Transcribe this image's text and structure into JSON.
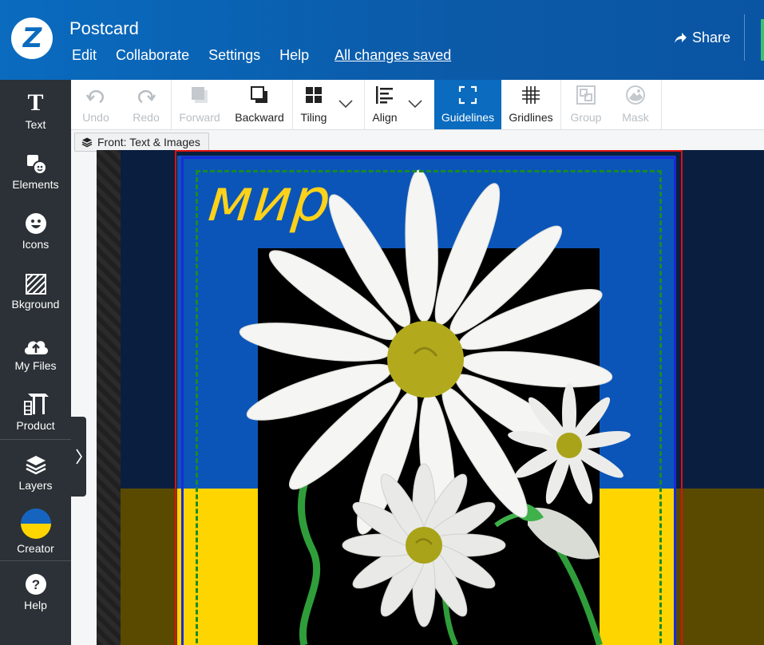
{
  "header": {
    "logo_letter": "Z",
    "title": "Postcard",
    "menu": [
      "Edit",
      "Collaborate",
      "Settings",
      "Help"
    ],
    "status": "All changes saved",
    "share_label": "Share"
  },
  "sidebar": {
    "items": [
      {
        "label": "Text",
        "icon": "text-icon"
      },
      {
        "label": "Elements",
        "icon": "elements-icon"
      },
      {
        "label": "Icons",
        "icon": "smiley-icon"
      },
      {
        "label": "Bkground",
        "icon": "background-icon"
      },
      {
        "label": "My Files",
        "icon": "upload-cloud-icon"
      },
      {
        "label": "Product",
        "icon": "product-icon"
      },
      {
        "label": "Layers",
        "icon": "layers-icon"
      },
      {
        "label": "Creator",
        "icon": "creator-avatar"
      },
      {
        "label": "Help",
        "icon": "help-icon"
      }
    ]
  },
  "toolbar": {
    "undo": "Undo",
    "redo": "Redo",
    "forward": "Forward",
    "backward": "Backward",
    "tiling": "Tiling",
    "align": "Align",
    "guidelines": "Guidelines",
    "gridlines": "Gridlines",
    "group": "Group",
    "mask": "Mask"
  },
  "layer_chip": "Front: Text & Images",
  "canvas": {
    "text": "мир",
    "colors": {
      "flag_blue": "#0b55b8",
      "flag_yellow": "#ffd500",
      "text_yellow": "#ffd21a"
    }
  }
}
